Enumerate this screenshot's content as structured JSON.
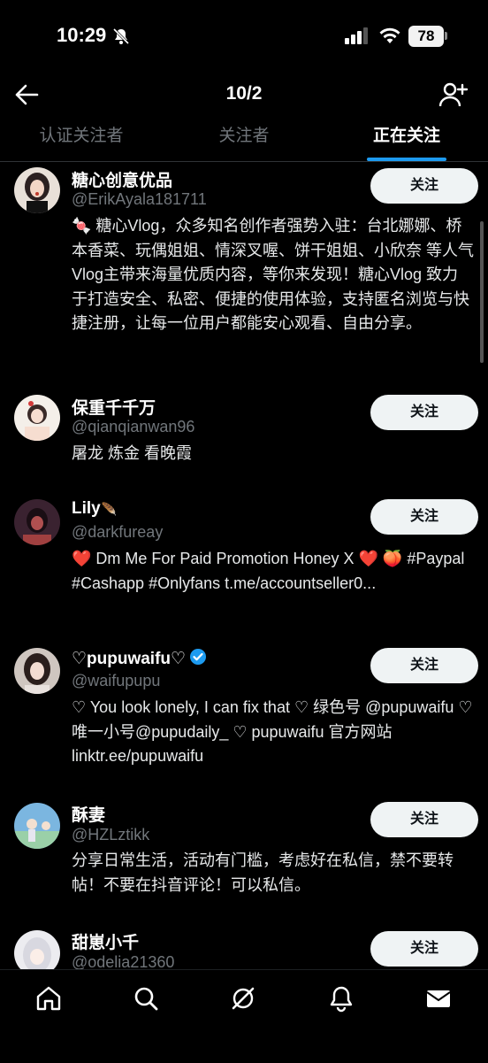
{
  "status_bar": {
    "time": "10:29",
    "battery": "78"
  },
  "header": {
    "title": "10/2"
  },
  "tabs": [
    {
      "label": "认证关注者"
    },
    {
      "label": "关注者"
    },
    {
      "label": "正在关注"
    }
  ],
  "users": [
    {
      "name": "糖心创意优品",
      "handle": "@ErikAyala181711",
      "bio": "🍬 糖心Vlog，众多知名创作者强势入驻：台北娜娜、桥本香菜、玩偶姐姐、情深叉喔、饼干姐姐、小欣奈 等人气Vlog主带来海量优质内容，等你来发现！糖心Vlog 致力于打造安全、私密、便捷的使用体验，支持匿名浏览与快捷注册，让每一位用户都能安心观看、自由分享。",
      "button": "关注"
    },
    {
      "name": "保重千千万",
      "handle": "@qianqianwan96",
      "bio": "屠龙 炼金 看晚霞",
      "button": "关注"
    },
    {
      "name": "Lily",
      "handle": "@darkfureay",
      "bio": "❤️ Dm Me For Paid Promotion Honey X ❤️ 🍑 #Paypal #Cashapp #Onlyfans t.me/accountseller0...",
      "button": "关注"
    },
    {
      "name": "♡pupuwaifu♡",
      "handle": "@waifupupu",
      "bio": "♡ You look lonely, I can fix that ♡ 绿色号 @pupuwaifu ♡ 唯一小号@pupudaily_ ♡ pupuwaifu 官方网站 linktr.ee/pupuwaifu",
      "button": "关注"
    },
    {
      "name": "酥妻",
      "handle": "@HZLztikk",
      "bio": "分享日常生活，活动有门槛，考虑好在私信，禁不要转帖！不要在抖音评论！可以私信。",
      "button": "关注"
    },
    {
      "name": "甜崽小千",
      "handle": "@odelia21360",
      "bio": "",
      "button": "关注"
    }
  ],
  "colors": {
    "accent": "#1d9bf0",
    "verified": "#1d9bf0",
    "background": "#000000"
  }
}
